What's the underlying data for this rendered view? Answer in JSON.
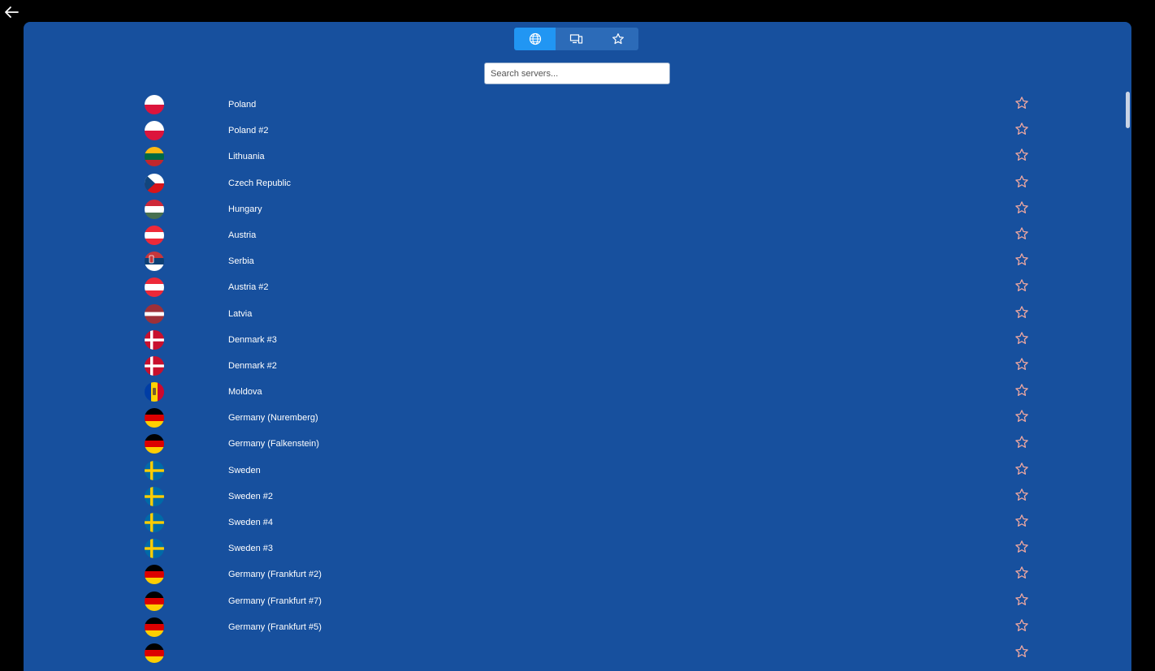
{
  "header": {
    "back_icon": "arrow-left-icon"
  },
  "tabs": [
    {
      "icon": "globe-icon",
      "active": true
    },
    {
      "icon": "devices-icon",
      "active": false
    },
    {
      "icon": "star-icon",
      "active": false
    }
  ],
  "search": {
    "placeholder": "Search servers...",
    "value": ""
  },
  "colors": {
    "background": "#000000",
    "panel": "#17509E",
    "tab": "#2C6BB8",
    "tab_active": "#2196F3",
    "favorite_star": "#F0A8A0"
  },
  "servers": [
    {
      "name": "Poland",
      "flag": "pl"
    },
    {
      "name": "Poland #2",
      "flag": "pl"
    },
    {
      "name": "Lithuania",
      "flag": "lt"
    },
    {
      "name": "Czech Republic",
      "flag": "cz"
    },
    {
      "name": "Hungary",
      "flag": "hu"
    },
    {
      "name": "Austria",
      "flag": "at"
    },
    {
      "name": "Serbia",
      "flag": "rs"
    },
    {
      "name": "Austria #2",
      "flag": "at"
    },
    {
      "name": "Latvia",
      "flag": "lv"
    },
    {
      "name": "Denmark #3",
      "flag": "dk"
    },
    {
      "name": "Denmark #2",
      "flag": "dk"
    },
    {
      "name": "Moldova",
      "flag": "md"
    },
    {
      "name": "Germany (Nuremberg)",
      "flag": "de"
    },
    {
      "name": "Germany (Falkenstein)",
      "flag": "de"
    },
    {
      "name": "Sweden",
      "flag": "se"
    },
    {
      "name": "Sweden #2",
      "flag": "se"
    },
    {
      "name": "Sweden #4",
      "flag": "se"
    },
    {
      "name": "Sweden #3",
      "flag": "se"
    },
    {
      "name": "Germany (Frankfurt #2)",
      "flag": "de"
    },
    {
      "name": "Germany (Frankfurt #7)",
      "flag": "de"
    },
    {
      "name": "Germany (Frankfurt #5)",
      "flag": "de"
    },
    {
      "name": "",
      "flag": "de"
    }
  ]
}
